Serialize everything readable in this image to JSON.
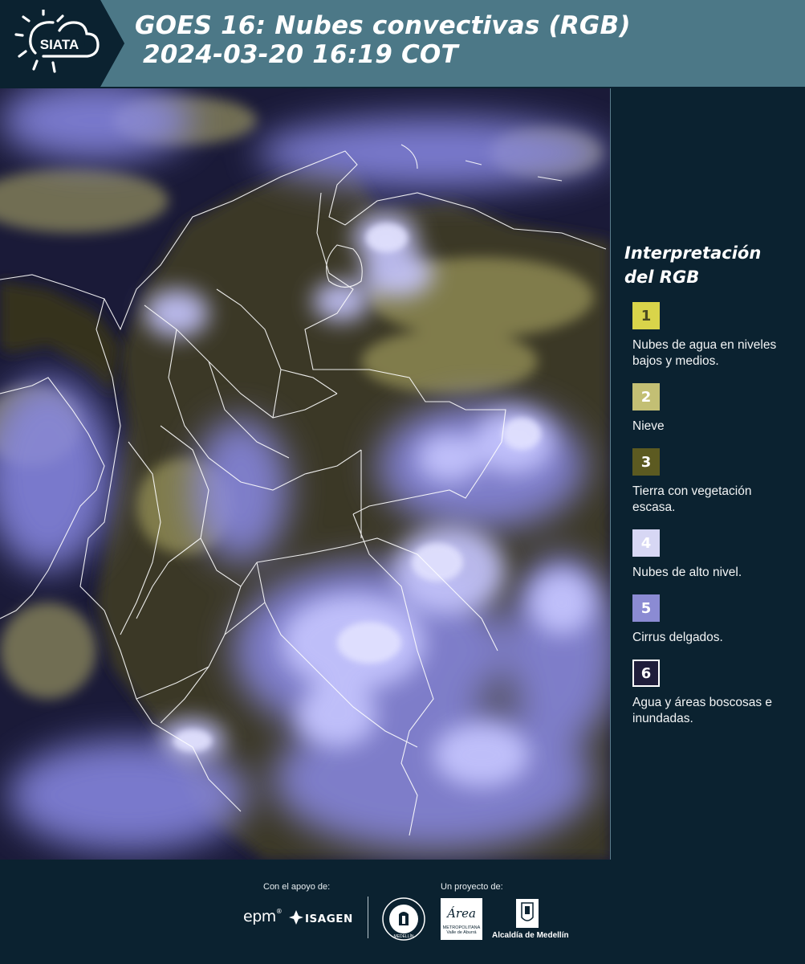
{
  "header": {
    "title": "GOES 16: Nubes convectivas (RGB)",
    "datetime": "2024-03-20 16:19 COT",
    "logo_text": "SIATA"
  },
  "legend": {
    "title": "Interpretación del RGB",
    "items": [
      {
        "number": "1",
        "label": "Nubes de agua en niveles bajos y medios.",
        "color": "#d9d44a",
        "text_color": "#4a4a20"
      },
      {
        "number": "2",
        "label": "Nieve",
        "color": "#c3bf74",
        "text_color": "#ffffff"
      },
      {
        "number": "3",
        "label": "Tierra con vegetación escasa.",
        "color": "#5c5a21",
        "text_color": "#ffffff"
      },
      {
        "number": "4",
        "label": "Nubes de alto nivel.",
        "color": "#d7d7f4",
        "text_color": "#ffffff"
      },
      {
        "number": "5",
        "label": "Cirrus delgados.",
        "color": "#8b8bd3",
        "text_color": "#ffffff"
      },
      {
        "number": "6",
        "label": "Agua y áreas boscosas e inundadas.",
        "color": "#1f1d3a",
        "text_color": "#ffffff"
      }
    ]
  },
  "footer": {
    "support_label": "Con el apoyo de:",
    "project_label": "Un proyecto de:",
    "sponsor_epm": "epm",
    "sponsor_isagen": "ISAGEN",
    "metro_name": "Área",
    "metro_sub1": "METROPOLITANA",
    "metro_sub2": "Valle de Aburrá",
    "alcaldia": "Alcaldía de Medellín",
    "medellin_seal_text": "MEDELLÍN"
  },
  "colors": {
    "background": "#0b2230",
    "header_band": "#4c7887",
    "high_cloud": "#c6c6ff",
    "low_cloud": "#d8d27a",
    "land": "#3a3825",
    "ocean": "#1a1a38"
  }
}
